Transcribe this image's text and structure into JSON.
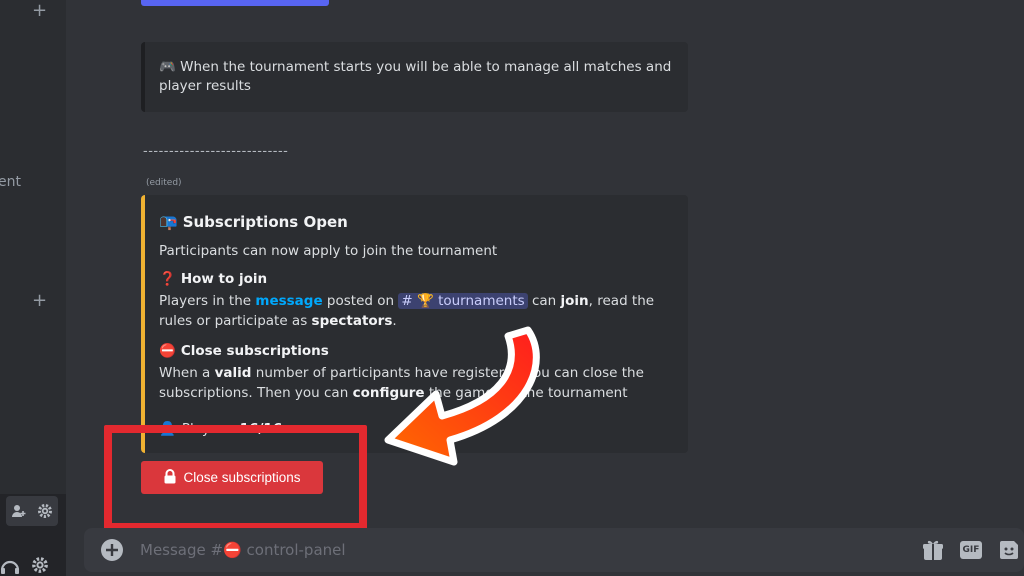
{
  "sidebar": {
    "partial_label": "ent"
  },
  "note": {
    "emoji": "🎮",
    "text": "When the tournament starts you will be able to manage all matches and player results"
  },
  "separator": "----------------------------",
  "edited_tag": "(edited)",
  "embed": {
    "accent_color": "#f0b232",
    "title_icon": "📭",
    "title": "Subscriptions Open",
    "description": "Participants can now apply to join the tournament",
    "how_to_join": {
      "icon": "❓",
      "name": "How to join",
      "parts": {
        "p1": "Players in the ",
        "link": "message",
        "p2": " posted on ",
        "channel_hash": "#",
        "channel_emoji": "🏆",
        "channel_name": "tournaments",
        "p3": " can ",
        "join": "join",
        "p4": ", read the rules or participate as ",
        "spectators": "spectators",
        "p5": "."
      }
    },
    "close_section": {
      "icon": "⛔",
      "name": "Close subscriptions",
      "parts": {
        "p1": "When a ",
        "valid": "valid",
        "p2": " number of participants have registered you can close the subscriptions. Then you can ",
        "configure": "configure",
        "p3": " the games in the tournament"
      }
    },
    "players": {
      "icon": "👤",
      "label": "Players: ",
      "value": "16/16"
    }
  },
  "close_button": {
    "icon": "🔒",
    "label": "Close subscriptions",
    "color": "#da373c"
  },
  "annotation_color": "#e3292f",
  "composer": {
    "placeholder": "Message #⛔ control-panel"
  },
  "composer_icons": [
    "add-circle-icon",
    "gift-icon",
    "gif-icon",
    "sticker-icon"
  ]
}
